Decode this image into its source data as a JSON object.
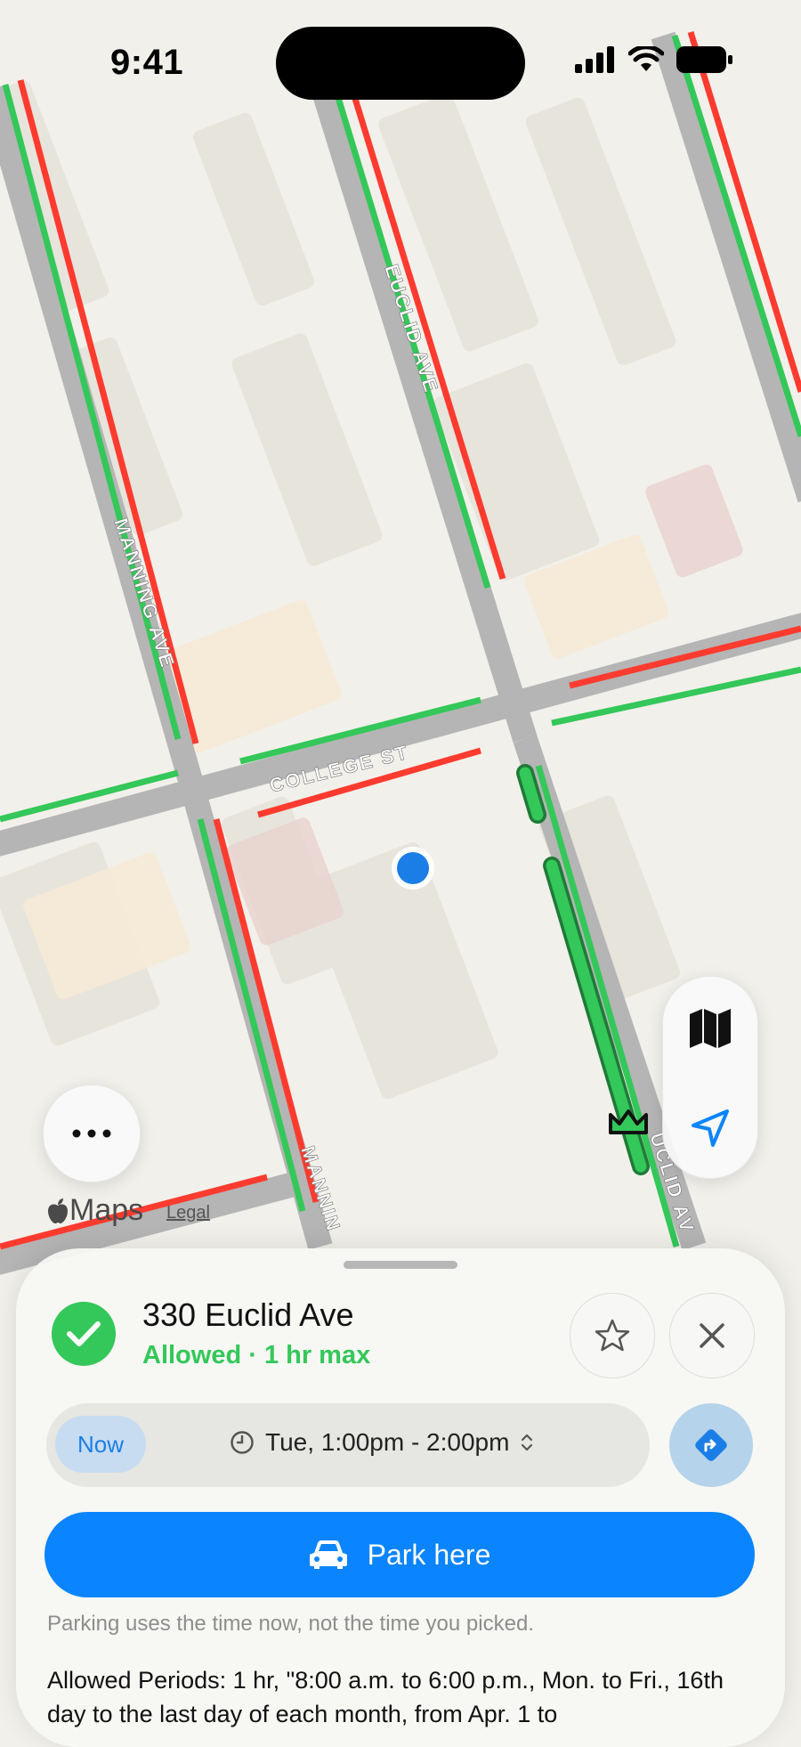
{
  "status_bar": {
    "time": "9:41"
  },
  "map": {
    "streets": [
      "EUCLID AVE",
      "MANNING AVE",
      "COLLEGE ST",
      "MANNIN",
      "UCLID AV"
    ],
    "attribution": "Maps",
    "legal_label": "Legal",
    "colors": {
      "allowed": "#34c759",
      "restricted": "#ff3b30",
      "location": "#1a7ee6"
    }
  },
  "sheet": {
    "address": "330 Euclid Ave",
    "rule": "Allowed · 1 hr max",
    "now_label": "Now",
    "time_range": "Tue, 1:00pm - 2:00pm",
    "park_label": "Park here",
    "hint": "Parking uses the time now, not the time you picked.",
    "allowed_periods": "Allowed Periods: 1 hr, \"8:00 a.m. to 6:00 p.m., Mon. to Fri., 16th day to the last day of each month, from Apr. 1 to"
  },
  "icons": {
    "check": "checkmark-icon",
    "favorite": "star-icon",
    "close": "close-icon",
    "clock": "clock-icon",
    "chevron": "chevron-up-down-icon",
    "directions": "directions-icon",
    "car": "car-icon",
    "map_mode": "map-icon",
    "locate": "location-arrow-icon",
    "more": "ellipsis-icon"
  }
}
